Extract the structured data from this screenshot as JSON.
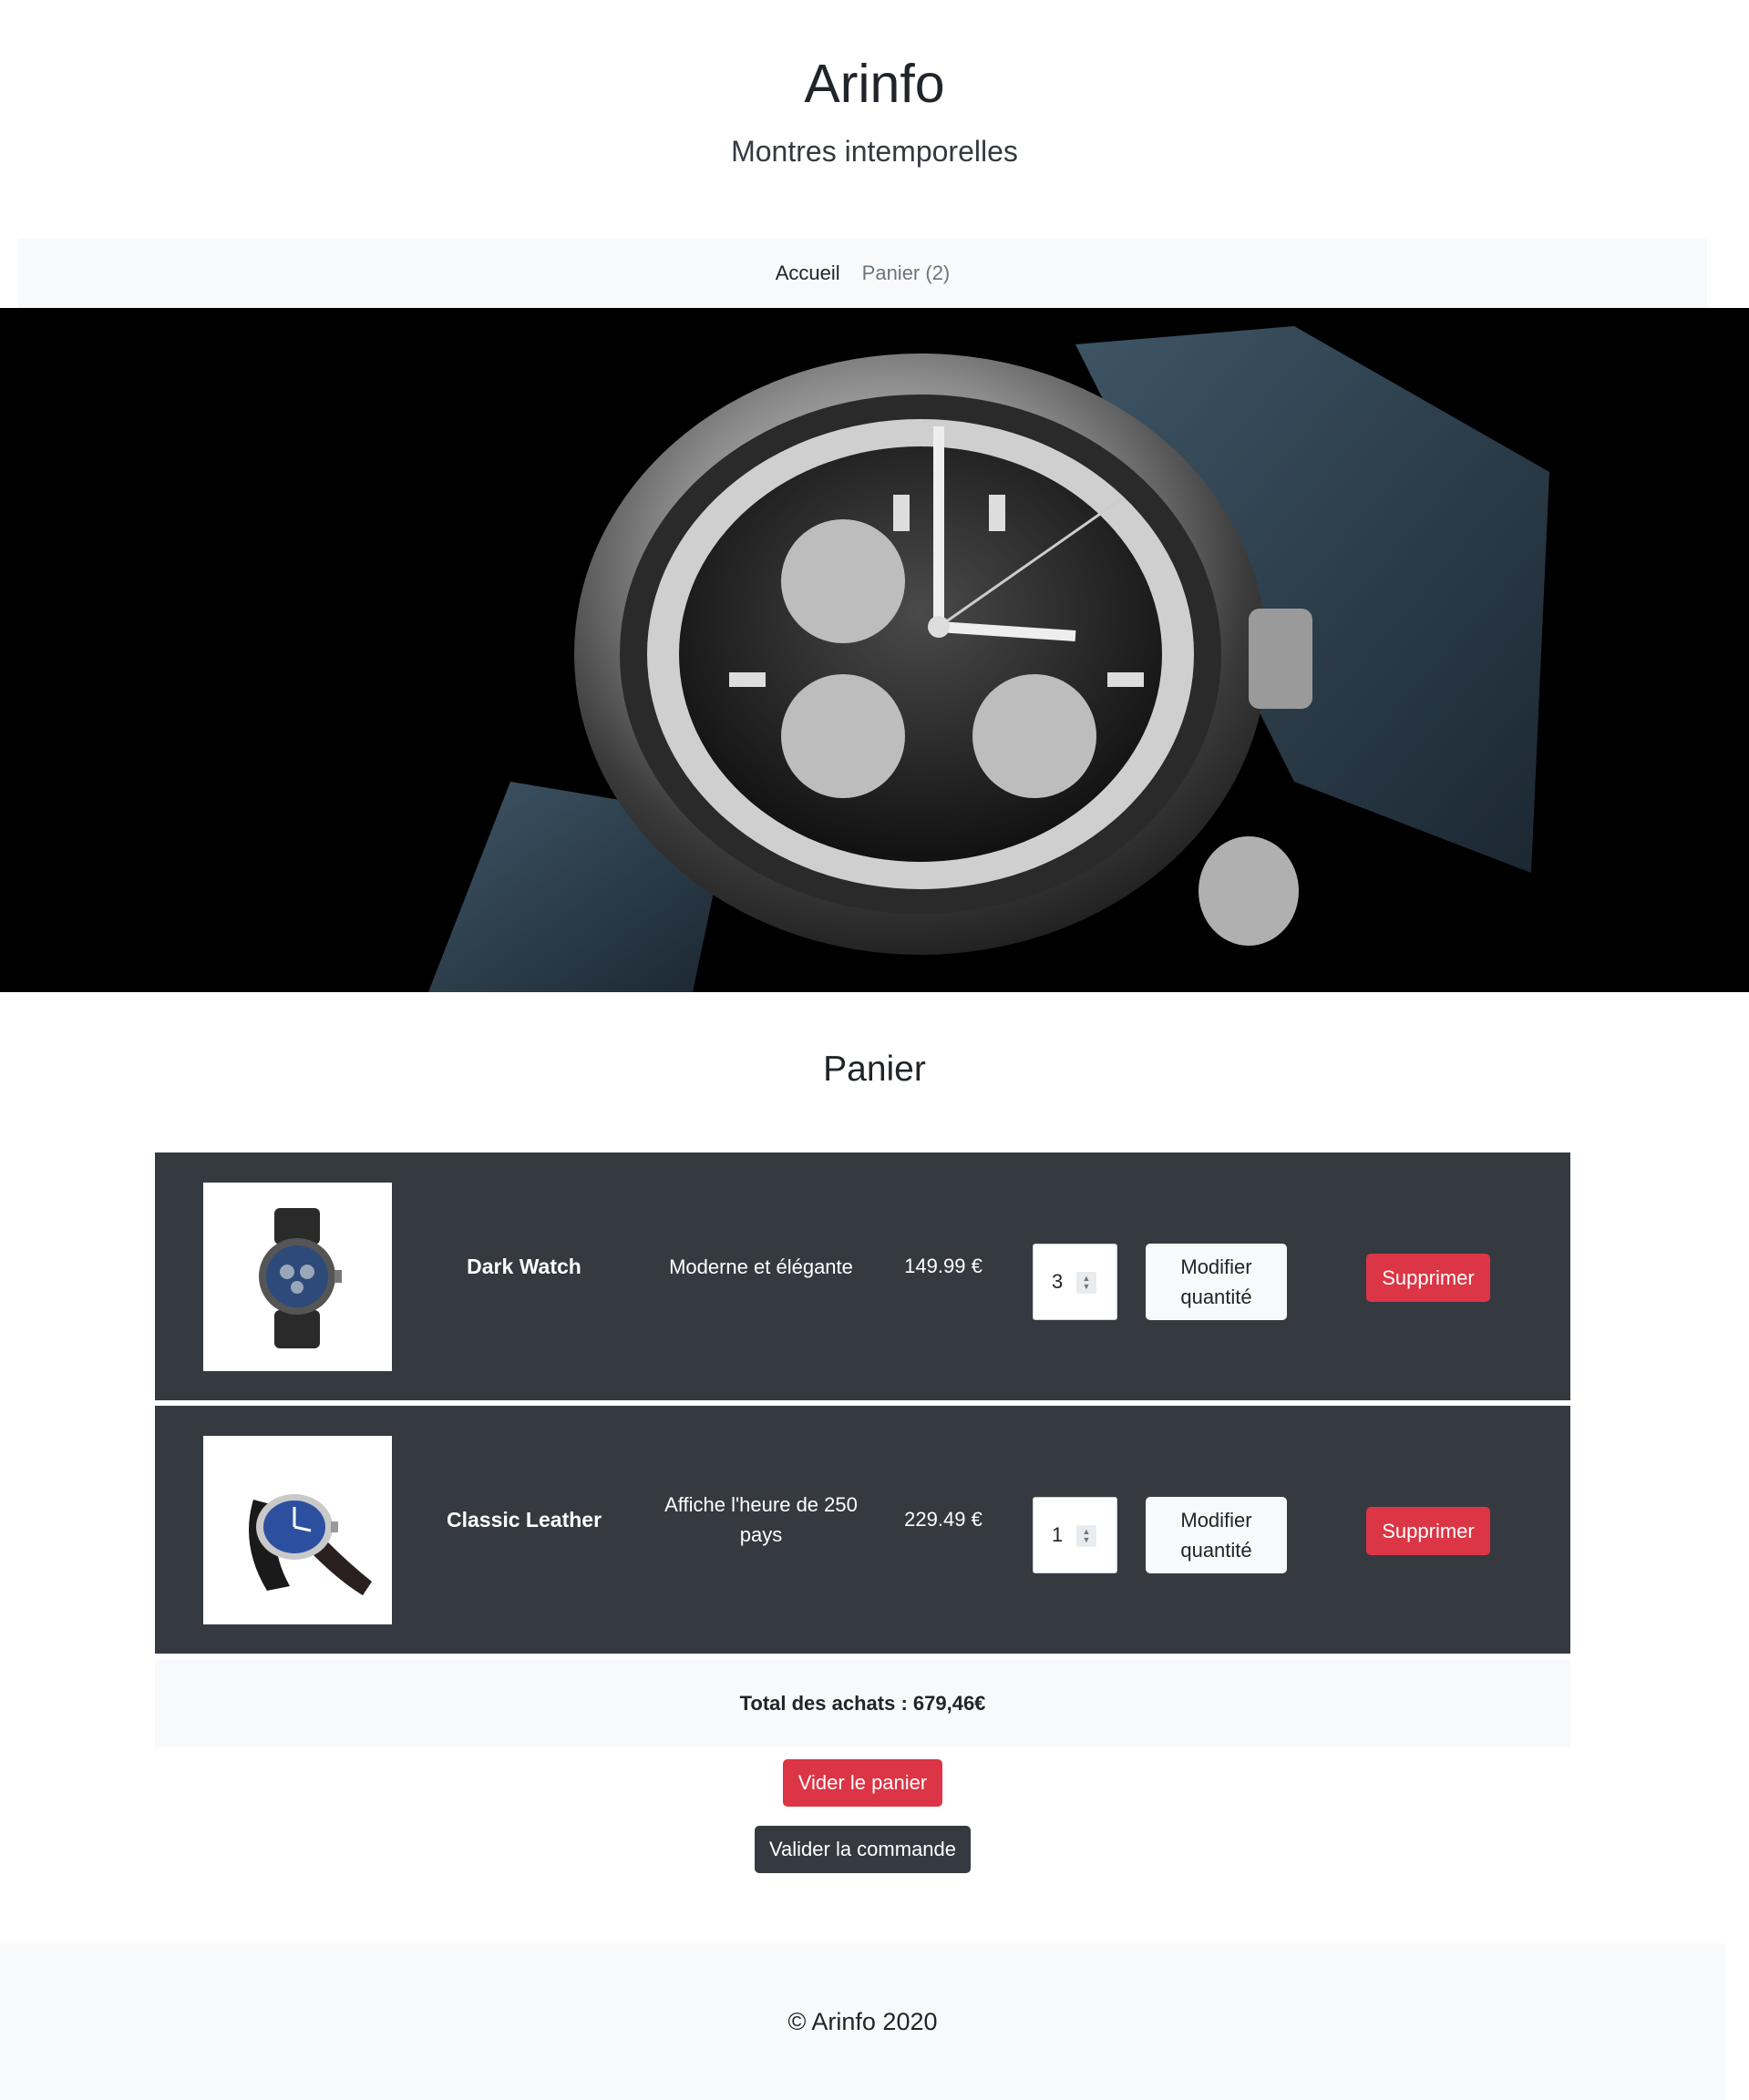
{
  "header": {
    "title": "Arinfo",
    "tagline": "Montres intemporelles"
  },
  "nav": {
    "items": [
      {
        "label": "Accueil"
      },
      {
        "label": "Panier (2)"
      }
    ]
  },
  "hero": {
    "image": "chronograph-watch-on-black"
  },
  "cart": {
    "title": "Panier",
    "items": [
      {
        "name": "Dark Watch",
        "description": "Moderne et élégante",
        "price": "149.99 €",
        "quantity": "3",
        "modify_label": "Modifier quantité",
        "delete_label": "Supprimer",
        "image": "dark-smartwatch"
      },
      {
        "name": "Classic Leather",
        "description": "Affiche l'heure de 250 pays",
        "price": "229.49 €",
        "quantity": "1",
        "modify_label": "Modifier quantité",
        "delete_label": "Supprimer",
        "image": "classic-leather-watch"
      }
    ],
    "total": "Total des achats : 679,46€",
    "empty_label": "Vider le panier",
    "validate_label": "Valider la commande"
  },
  "footer": {
    "text": "© Arinfo 2020"
  },
  "colors": {
    "row_bg": "#343a40",
    "light_bg": "#f8f9fa",
    "danger": "#dc3545",
    "dark_button": "#343a40"
  }
}
